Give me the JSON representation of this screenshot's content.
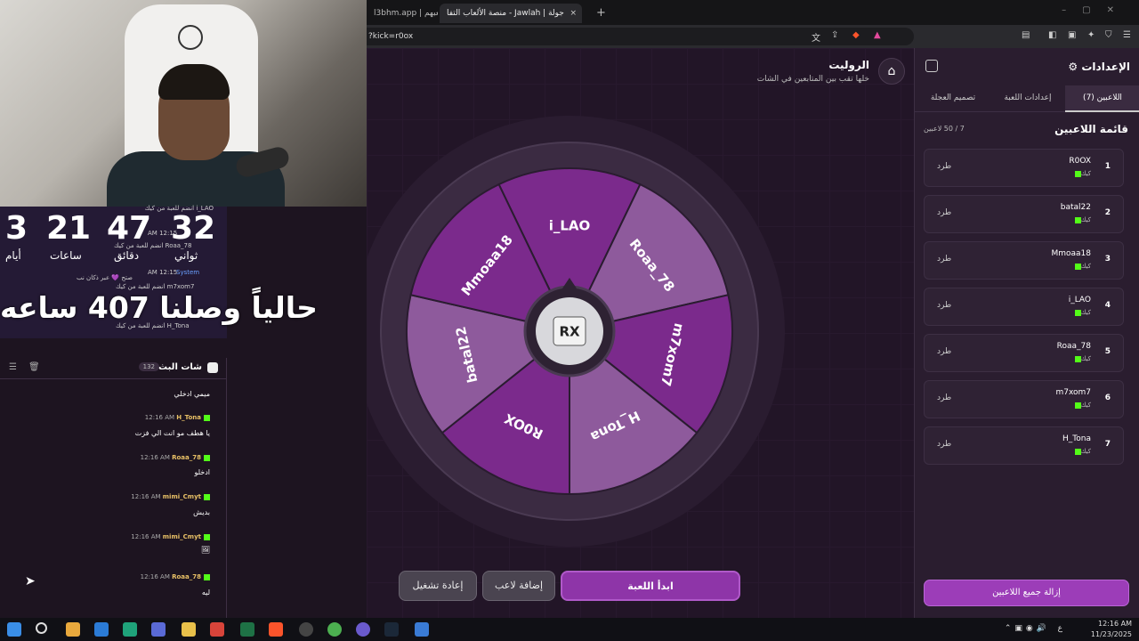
{
  "browser": {
    "tab1_label": "l3bhm.app | لعبهم",
    "tab2_label": "منصة الألعاب التفا - Jawlah | جولة",
    "tab2_close": "×",
    "new_tab": "+",
    "url": "?kick=r0ox"
  },
  "page": {
    "title": "الروليت",
    "subtitle": "خلها تقب بين المتابعين في الشات",
    "wheel_center_logo": "RX",
    "wheel_segments": [
      "i_LAO",
      "Roaa_78",
      "m7xom7",
      "H_Tona",
      "R0OX",
      "batal22",
      "Mmoaa18"
    ],
    "wheel_colors": {
      "dark": "#7b2a8c",
      "light": "#8e5a9c"
    },
    "buttons": {
      "start": "ابدأ اللعبة",
      "add_player": "إضافة لاعب",
      "reset": "إعادة تشغيل"
    }
  },
  "settings": {
    "title": "الإعدادات",
    "tabs": [
      "اللاعبين (7)",
      "إعدادات اللعبة",
      "تصميم العجلة"
    ],
    "list_title": "قائمة اللاعبين",
    "list_count": "7 / 50 لاعبين",
    "kick_label": "طرد",
    "platform_label": "كيك",
    "players": [
      {
        "num": "1",
        "name": "R0OX"
      },
      {
        "num": "2",
        "name": "batal22"
      },
      {
        "num": "3",
        "name": "Mmoaa18"
      },
      {
        "num": "4",
        "name": "i_LAO"
      },
      {
        "num": "5",
        "name": "Roaa_78"
      },
      {
        "num": "6",
        "name": "m7xom7"
      },
      {
        "num": "7",
        "name": "H_Tona"
      }
    ],
    "clear_all": "إزالة جميع اللاعبين"
  },
  "overlay": {
    "countdown": {
      "days": "3",
      "hours": "21",
      "minutes": "47",
      "seconds": "32",
      "days_lbl": "أيام",
      "hours_lbl": "ساعات",
      "minutes_lbl": "دقائق",
      "seconds_lbl": "ثواني"
    },
    "hours_text": "حالياً وصلنا 407 ساعه",
    "sys1": "Roaa_78 انضم للعبة من كيك",
    "sys_time": "12:15 AM",
    "sys_name": "System",
    "sys2": "m7xom7 انضم للعبة من كيك",
    "sys2_extra": "صتح 💜 عبر ذكان نب",
    "sys3": "H_Tona انضم للعبة من كيك",
    "sys0": "i_LAO انضم للعبة من كيك"
  },
  "chat": {
    "title": "شات البث",
    "count": "132",
    "messages": [
      {
        "user": "",
        "time": "",
        "text": "ميمي ادخلي"
      },
      {
        "user": "H_Tona",
        "time": "12:16 AM",
        "text": "يا هطف مو انت الي فزت"
      },
      {
        "user": "Roaa_78",
        "time": "12:16 AM",
        "text": "ادخلو"
      },
      {
        "user": "mimi_Cmyt",
        "time": "12:16 AM",
        "text": "بديش"
      },
      {
        "user": "mimi_Cmyt",
        "time": "12:16 AM",
        "text": "🖼"
      },
      {
        "user": "Roaa_78",
        "time": "12:16 AM",
        "text": "ليه"
      }
    ]
  },
  "taskbar": {
    "time": "12:16 AM",
    "date": "11/23/2025",
    "lang": "ع"
  }
}
